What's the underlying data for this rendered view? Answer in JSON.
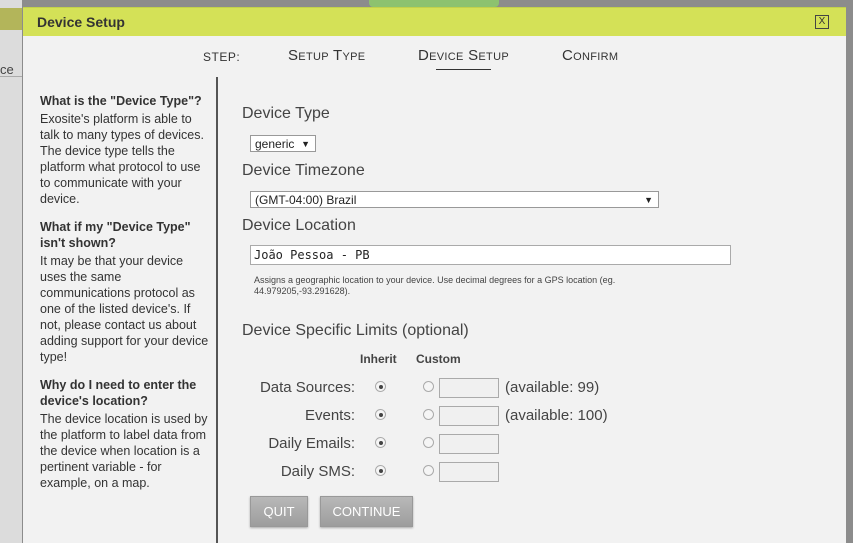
{
  "background": {
    "partial_text": "ce"
  },
  "dialog": {
    "title": "Device Setup",
    "close_label": "X"
  },
  "steps": {
    "label": "STEP:",
    "items": [
      "Setup Type",
      "Device Setup",
      "Confirm"
    ],
    "active": "Device Setup"
  },
  "sidebar": {
    "sections": [
      {
        "heading": "What is the \"Device Type\"?",
        "body": "Exosite's platform is able to talk to many types of devices. The device type tells the platform what protocol to use to communicate with your device."
      },
      {
        "heading": "What if my \"Device Type\" isn't shown?",
        "body": "It may be that your device uses the same communications protocol as one of the listed device's. If not, please contact us about adding support for your device type!"
      },
      {
        "heading": "Why do I need to enter the device's location?",
        "body": "The device location is used by the platform to label data from the device when location is a pertinent variable - for example, on a map."
      }
    ]
  },
  "form": {
    "device_type": {
      "label": "Device Type",
      "value": "generic"
    },
    "timezone": {
      "label": "Device Timezone",
      "value": "(GMT-04:00) Brazil"
    },
    "location": {
      "label": "Device Location",
      "value": "João Pessoa - PB",
      "help": "Assigns a geographic location to your device. Use decimal degrees for a GPS location (eg. 44.979205,-93.291628)."
    },
    "limits": {
      "label": "Device Specific Limits (optional)",
      "col_inherit": "Inherit",
      "col_custom": "Custom",
      "rows": [
        {
          "label": "Data Sources:",
          "available": "(available: 99)"
        },
        {
          "label": "Events:",
          "available": "(available: 100)"
        },
        {
          "label": "Daily Emails:",
          "available": ""
        },
        {
          "label": "Daily SMS:",
          "available": ""
        }
      ]
    },
    "buttons": {
      "quit": "QUIT",
      "continue": "CONTINUE"
    }
  }
}
